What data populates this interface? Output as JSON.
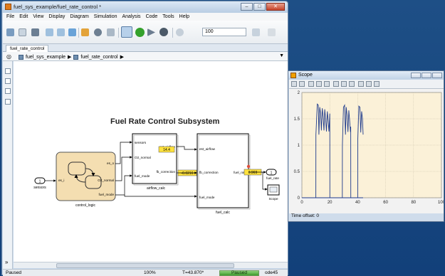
{
  "simulink": {
    "title": "fuel_sys_example/fuel_rate_control *",
    "menu": [
      "File",
      "Edit",
      "View",
      "Display",
      "Diagram",
      "Simulation",
      "Analysis",
      "Code",
      "Tools",
      "Help"
    ],
    "stop_time": "100",
    "tab": "fuel_rate_control",
    "breadcrumb": [
      "fuel_sys_example",
      "fuel_rate_control"
    ],
    "status": {
      "left": "Paused",
      "zoom": "100%",
      "time": "T=43.870*",
      "progress": "Paused",
      "solver": "ode45"
    }
  },
  "diagram": {
    "title": "Fuel Rate Control Subsystem",
    "inport": {
      "num": "1",
      "label": "sensors"
    },
    "outport": {
      "num": "1",
      "label": "fuel_rate"
    },
    "control_logic": {
      "in": "es_i",
      "outs": [
        "es_o",
        "O2_normal",
        "fuel_mode"
      ],
      "label": "control_logic"
    },
    "airflow_calc": {
      "ins": [
        "sensors",
        "O2_normal",
        "fuel_mode"
      ],
      "outs": [
        "est_airflow",
        "fb_correction"
      ],
      "label": "airflow_calc"
    },
    "fuel_calc": {
      "ins": [
        "est_airflow",
        "fb_correction",
        "fuel_mode"
      ],
      "out": "fuel_rate",
      "label": "fuel_calc"
    },
    "displays": {
      "est_airflow": "14.4",
      "fb_correction": "-0.0216",
      "fuel_rate": "0.969"
    },
    "scope_label": "Scope"
  },
  "scope": {
    "title": "Scope",
    "time_offset_label": "Time offset:",
    "time_offset": "0"
  },
  "chart_data": {
    "type": "line",
    "title": "",
    "xlabel": "",
    "ylabel": "",
    "xlim": [
      0,
      100
    ],
    "ylim": [
      0,
      2
    ],
    "xticks": [
      "0",
      "20",
      "40",
      "60",
      "80",
      "100"
    ],
    "yticks": [
      "0",
      "0.5",
      "1",
      "1.5",
      "2"
    ],
    "grid": true,
    "series": [
      {
        "x": [
          0,
          10,
          10.05,
          15,
          15.05,
          20,
          20.05,
          29,
          29.05,
          35,
          35.05,
          40,
          40.05,
          43.87
        ],
        "y": [
          0,
          0,
          0,
          0,
          0,
          0,
          0,
          0,
          0,
          0,
          0,
          0,
          0,
          0
        ]
      },
      {
        "x": [
          10,
          10.05,
          11,
          11.8,
          12.2,
          12.8,
          13.4,
          14,
          14.6,
          15.2,
          15.8,
          16.4,
          17,
          17.6,
          18.2,
          18.8,
          19.4,
          20,
          20.05
        ],
        "y": [
          0,
          1.2,
          1.78,
          1.76,
          1.2,
          1.72,
          1.6,
          1.28,
          1.7,
          1.54,
          1.28,
          1.68,
          1.5,
          1.26,
          1.64,
          1.48,
          1.26,
          1.6,
          0
        ]
      },
      {
        "x": [
          29,
          29.05,
          29.8,
          30.6,
          31.2,
          31.8,
          32.4,
          33,
          33.6,
          34.2,
          34.8,
          35,
          35.05
        ],
        "y": [
          0,
          1.0,
          1.72,
          1.76,
          1.2,
          1.72,
          1.56,
          1.25,
          1.66,
          1.48,
          1.25,
          1.35,
          0
        ]
      },
      {
        "x": [
          40,
          40.05,
          40.8,
          41.6,
          42.2,
          42.8,
          43.4,
          43.87
        ],
        "y": [
          0,
          1.1,
          1.74,
          1.72,
          1.24,
          1.64,
          1.5,
          1.2
        ]
      }
    ],
    "line_color": "#1f3b8c",
    "background": "#fbf1d8"
  }
}
